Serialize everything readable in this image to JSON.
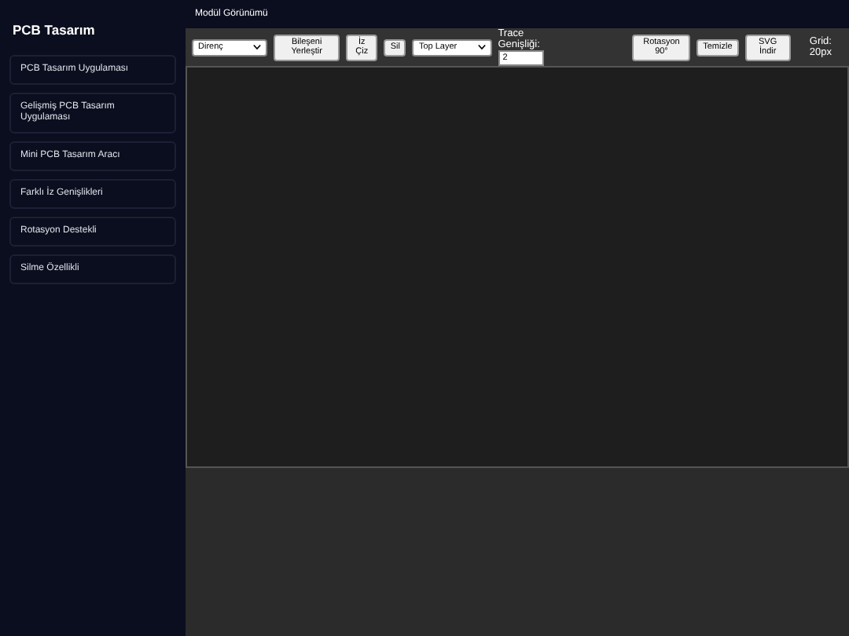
{
  "sidebar": {
    "title": "PCB Tasarım",
    "items": [
      {
        "label": "PCB Tasarım Uygulaması",
        "selected": false
      },
      {
        "label": "Gelişmiş PCB Tasarım Uygulaması",
        "selected": false
      },
      {
        "label": "Mini PCB Tasarım Aracı",
        "selected": false
      },
      {
        "label": "Farklı İz Genişlikleri",
        "selected": false
      },
      {
        "label": "Rotasyon Destekli",
        "selected": false
      },
      {
        "label": "Silme Özellikli",
        "selected": false
      }
    ]
  },
  "header": {
    "title": "Modül Görünümü"
  },
  "toolbar": {
    "component_select": "Direnç",
    "place_button": "Bileşeni Yerleştir",
    "trace_button": "İz Çiz",
    "delete_button": "Sil",
    "layer_select": "Top Layer",
    "trace_width_label": "Trace Genişliği:",
    "trace_width_value": "2",
    "rotate_button": "Rotasyon 90°",
    "clear_button": "Temizle",
    "export_button": "SVG İndir",
    "grid_label": "Grid: 20px"
  }
}
